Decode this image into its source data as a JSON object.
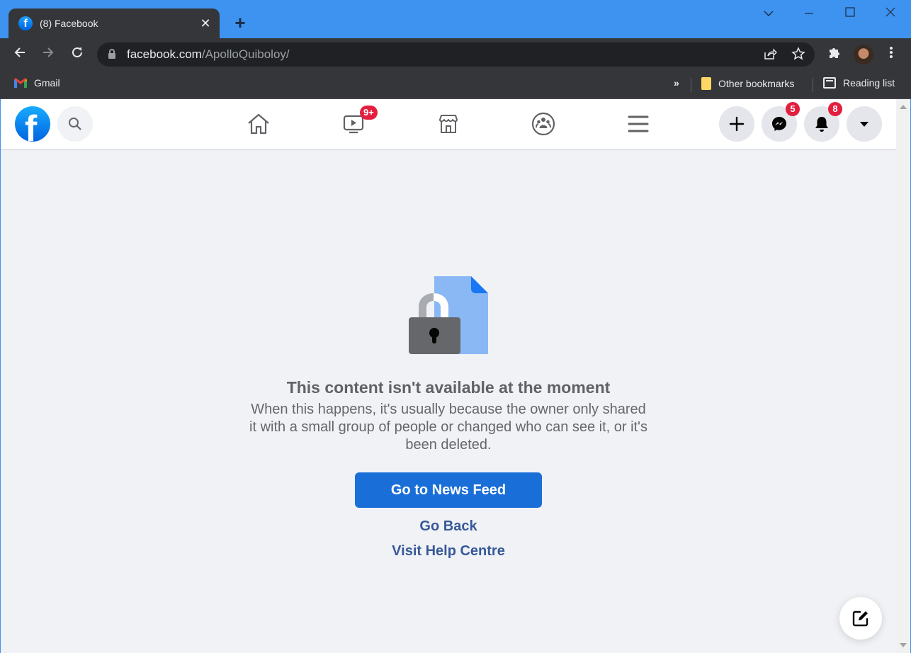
{
  "browser": {
    "tab": {
      "title": "(8) Facebook",
      "favicon": "facebook-favicon",
      "close_icon": "close-icon"
    },
    "new_tab_icon": "plus-icon",
    "window_controls": {
      "tab_search": "chevron-down-icon",
      "minimize": "minimize-icon",
      "maximize": "maximize-icon",
      "close": "close-icon"
    },
    "toolbar": {
      "back_icon": "arrow-left-icon",
      "forward_icon": "arrow-right-icon",
      "reload_icon": "reload-icon",
      "url_domain": "facebook.com",
      "url_path": "/ApolloQuiboloy/",
      "share_icon": "share-icon",
      "bookmark_icon": "star-icon",
      "extensions_icon": "puzzle-icon",
      "menu_icon": "kebab-menu-icon"
    },
    "bookmarks": {
      "items": [
        {
          "label": "Gmail",
          "icon": "gmail-icon"
        }
      ],
      "overflow": "»",
      "other_bookmarks": "Other bookmarks",
      "reading_list": "Reading list"
    }
  },
  "facebook": {
    "header": {
      "logo": "f",
      "nav": [
        {
          "name": "home",
          "icon": "home-icon"
        },
        {
          "name": "watch",
          "icon": "video-icon",
          "badge": "9+"
        },
        {
          "name": "marketplace",
          "icon": "marketplace-icon"
        },
        {
          "name": "groups",
          "icon": "groups-icon"
        },
        {
          "name": "menu",
          "icon": "hamburger-icon"
        }
      ],
      "actions": [
        {
          "name": "create",
          "icon": "plus-icon"
        },
        {
          "name": "messenger",
          "icon": "messenger-icon",
          "badge": "5"
        },
        {
          "name": "notifications",
          "icon": "bell-icon",
          "badge": "8"
        },
        {
          "name": "account",
          "icon": "caret-down-icon"
        }
      ]
    },
    "error": {
      "title": "This content isn't available at the moment",
      "description": "When this happens, it's usually because the owner only shared it with a small group of people or changed who can see it, or it's been deleted.",
      "primary_button": "Go to News Feed",
      "go_back": "Go Back",
      "help": "Visit Help Centre"
    },
    "colors": {
      "brand": "#1877f2",
      "button": "#1a6ed8",
      "link": "#385898",
      "badge": "#e41e3f"
    }
  }
}
